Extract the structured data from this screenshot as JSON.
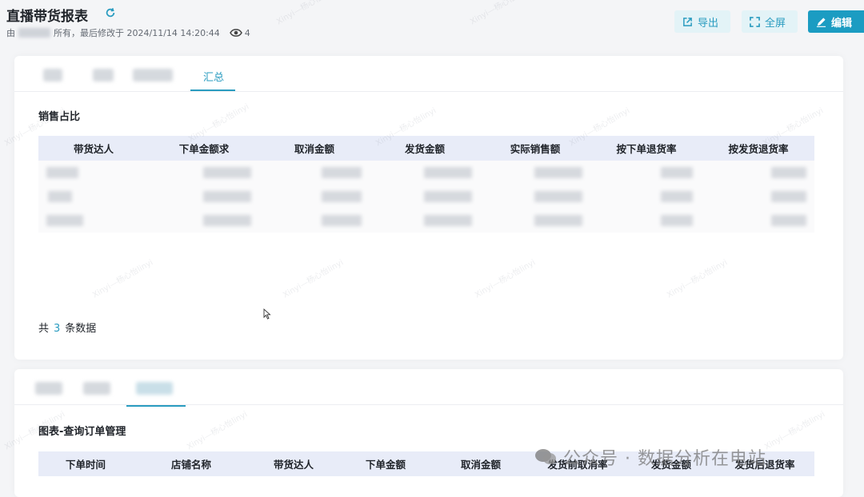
{
  "header": {
    "title": "直播带货报表",
    "meta_prefix": "由",
    "meta_suffix": "所有，最后修改于 2024/11/14 14:20:44",
    "views": "4",
    "export_label": "导出",
    "fullscreen_label": "全屏",
    "edit_label": "编辑"
  },
  "card1": {
    "active_tab": "汇总",
    "section_title": "销售占比",
    "columns": [
      "带货达人",
      "下单金额求",
      "取消金额",
      "发货金额",
      "实际销售额",
      "按下单退货率",
      "按发货退货率"
    ],
    "footer_prefix": "共",
    "footer_count": "3",
    "footer_suffix": "条数据"
  },
  "card2": {
    "section_title": "图表-查询订单管理",
    "columns": [
      "下单时间",
      "店铺名称",
      "带货达人",
      "下单金额",
      "取消金额",
      "发货前取消率",
      "发货金额",
      "发货后退货率"
    ]
  },
  "watermark_text": "Xinyi—杨心怡linyi",
  "brand": "公众号 · 数据分析在电站",
  "colors": {
    "accent": "#2a9cc0",
    "primary_button": "#1b9cc2",
    "table_header": "#e8ecf8"
  }
}
